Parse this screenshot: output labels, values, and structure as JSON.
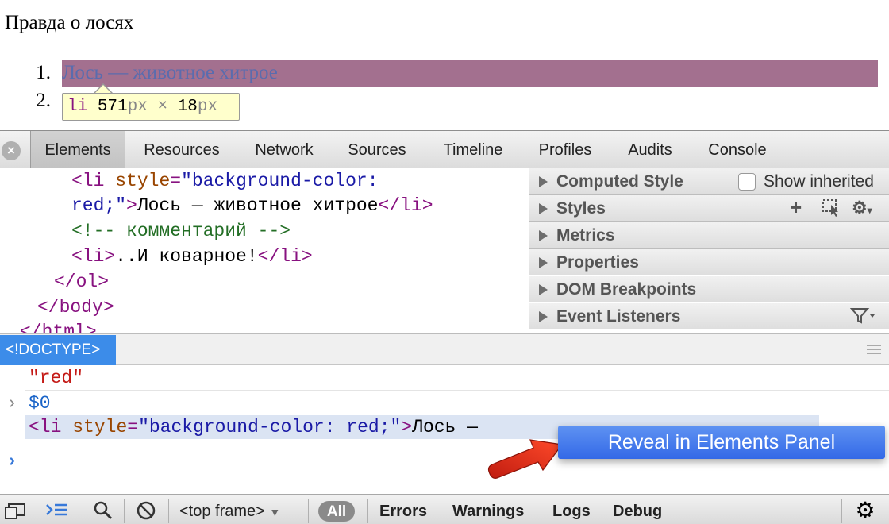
{
  "page": {
    "title": "Правда о лосях",
    "list": [
      {
        "number": "1.",
        "text": "Лось — животное хитрое"
      },
      {
        "number": "2.",
        "text": ""
      }
    ],
    "tooltip": {
      "tag": "li",
      "width_val": "571",
      "width_unit": "px",
      "times": " × ",
      "height_val": "18",
      "height_unit": "px"
    }
  },
  "devtools": {
    "tabs": [
      "Elements",
      "Resources",
      "Network",
      "Sources",
      "Timeline",
      "Profiles",
      "Audits",
      "Console"
    ],
    "active_tab": "Elements",
    "dom": {
      "line1": {
        "open": "<li",
        "attr": "style",
        "eq": "=",
        "val_a": "\"background-color:"
      },
      "line2": {
        "val_b": "red;\"",
        "close_open": ">",
        "text": "Лось — животное хитрое",
        "end": "</li>"
      },
      "line3": "<!-- комментарий -->",
      "line4": {
        "open": "<li>",
        "text": "..И коварное!",
        "end": "</li>"
      },
      "line5": "</ol>",
      "line6": "</body>",
      "line7": "</html>"
    },
    "sidebar": {
      "sections": [
        "Computed Style",
        "Styles",
        "Metrics",
        "Properties",
        "DOM Breakpoints",
        "Event Listeners"
      ],
      "show_inherited": "Show inherited"
    },
    "breadcrumb": "<!DOCTYPE>",
    "console": {
      "result_str": "\"red\"",
      "input_cmd": "$0",
      "output": {
        "open": "<li",
        "attr": "style",
        "eq": "=",
        "val": "\"background-color: red;\"",
        "gt": ">",
        "text": "Лось —"
      },
      "prompt": "›",
      "chevron": "›"
    },
    "context_menu": "Reveal in Elements Panel",
    "bottom": {
      "frame": "<top frame>",
      "filters": [
        "All",
        "Errors",
        "Warnings",
        "Logs",
        "Debug"
      ]
    }
  },
  "colors": {
    "highlight": "#a3708f",
    "crumb": "#3c8ce9",
    "menu": "#3f76eb",
    "arrow": "#e0301e"
  }
}
